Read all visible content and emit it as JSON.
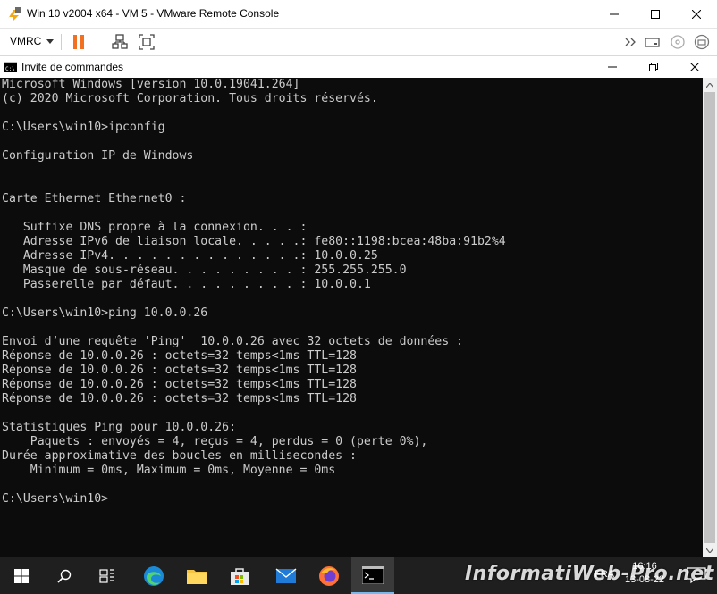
{
  "window": {
    "title": "Win 10 v2004 x64 - VM 5 - VMware Remote Console",
    "minimize_icon": "minimize-icon",
    "maximize_icon": "maximize-icon",
    "close_icon": "close-icon"
  },
  "toolbar": {
    "menu_label": "VMRC",
    "icons": [
      "pause-icon",
      "network-icon",
      "fullscreen-icon",
      "send-keys-icon",
      "removable-devices-icon",
      "cd-icon",
      "settings-icon"
    ]
  },
  "cmd": {
    "title": "Invite de commandes",
    "lines": [
      "Microsoft Windows [version 10.0.19041.264]",
      "(c) 2020 Microsoft Corporation. Tous droits réservés.",
      "",
      "C:\\Users\\win10>ipconfig",
      "",
      "Configuration IP de Windows",
      "",
      "",
      "Carte Ethernet Ethernet0 :",
      "",
      "   Suffixe DNS propre à la connexion. . . :",
      "   Adresse IPv6 de liaison locale. . . . .: fe80::1198:bcea:48ba:91b2%4",
      "   Adresse IPv4. . . . . . . . . . . . . .: 10.0.0.25",
      "   Masque de sous-réseau. . . . . . . . . : 255.255.255.0",
      "   Passerelle par défaut. . . . . . . . . : 10.0.0.1",
      "",
      "C:\\Users\\win10>ping 10.0.0.26",
      "",
      "Envoi d’une requête 'Ping'  10.0.0.26 avec 32 octets de données :",
      "Réponse de 10.0.0.26 : octets=32 temps<1ms TTL=128",
      "Réponse de 10.0.0.26 : octets=32 temps<1ms TTL=128",
      "Réponse de 10.0.0.26 : octets=32 temps<1ms TTL=128",
      "Réponse de 10.0.0.26 : octets=32 temps<1ms TTL=128",
      "",
      "Statistiques Ping pour 10.0.0.26:",
      "    Paquets : envoyés = 4, reçus = 4, perdus = 0 (perte 0%),",
      "Durée approximative des boucles en millisecondes :",
      "    Minimum = 0ms, Maximum = 0ms, Moyenne = 0ms",
      "",
      "C:\\Users\\win10>"
    ]
  },
  "taskbar": {
    "items": [
      "start-icon",
      "search-icon",
      "task-view-icon",
      "edge-icon",
      "file-explorer-icon",
      "store-icon",
      "mail-icon",
      "firefox-icon",
      "cmd-icon"
    ],
    "language": "FRA",
    "time": "16:16",
    "date": "13-08-22"
  },
  "watermark": "InformatiWeb-Pro.net",
  "colors": {
    "console_bg": "#0c0c0c",
    "console_text": "#cccccc",
    "pause_orange": "#f37021",
    "taskbar_bg": "#1f1f1f"
  }
}
